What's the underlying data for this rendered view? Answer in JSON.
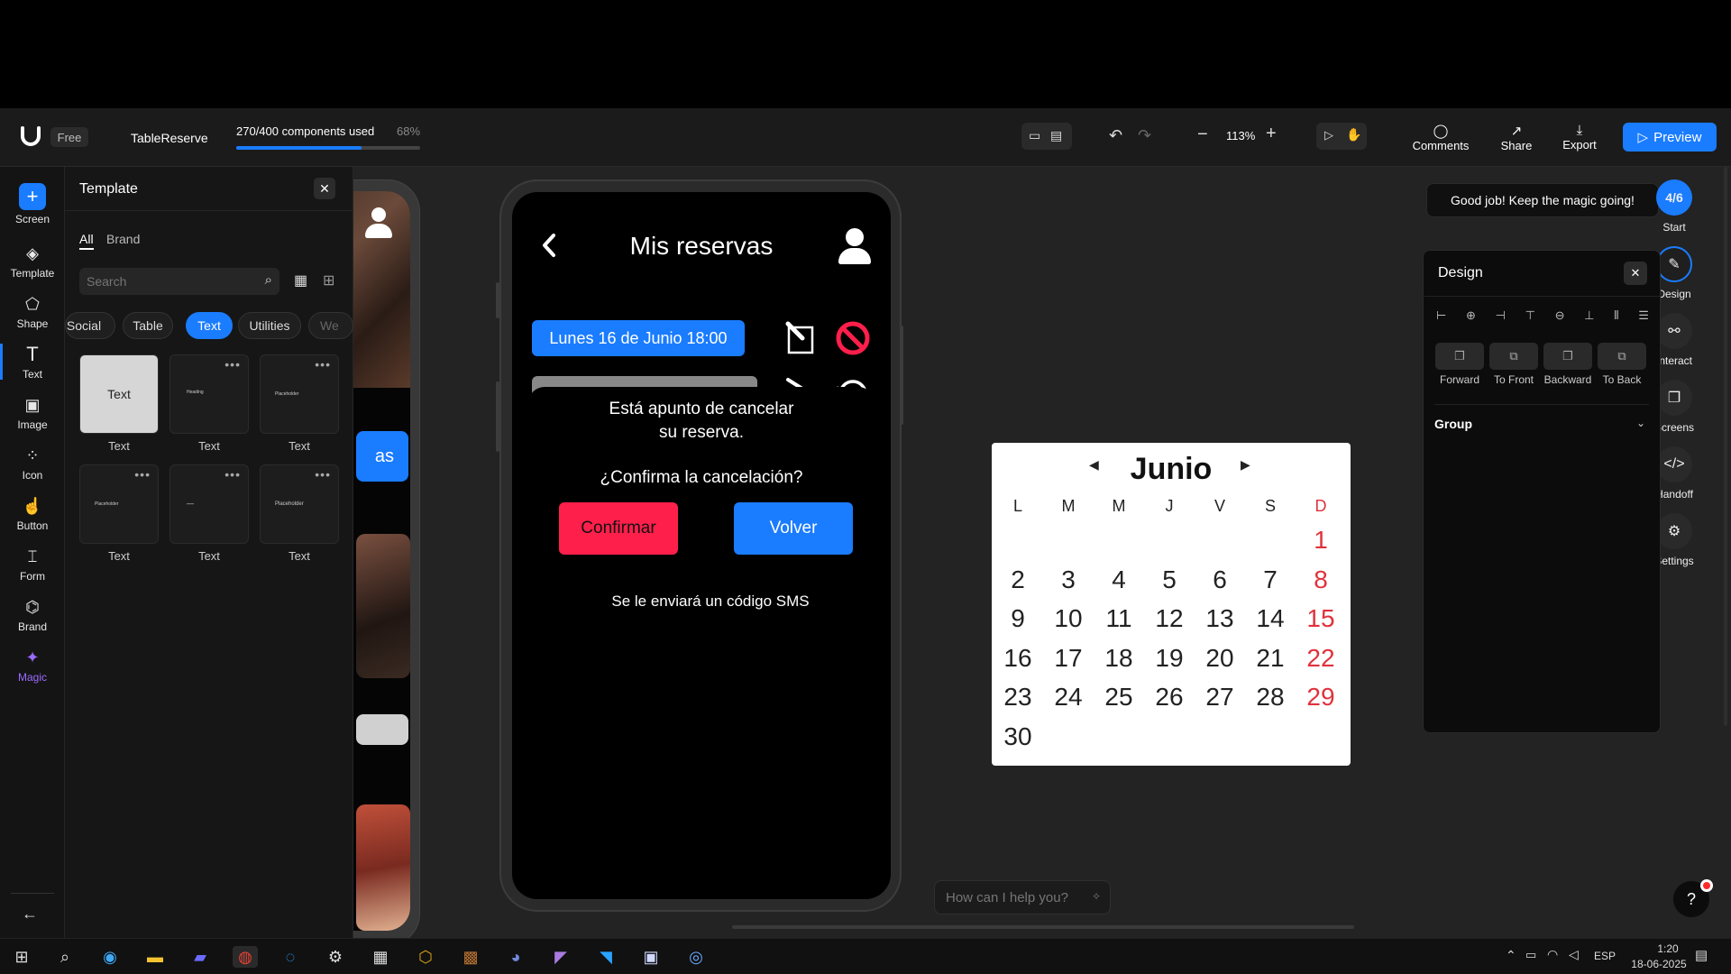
{
  "app": {
    "plan_badge": "Free",
    "project_name": "TableReserve",
    "usage_text": "270/400 components used",
    "usage_percent_label": "68%",
    "usage_fraction": 0.68,
    "zoom": "113%",
    "comments_label": "Comments",
    "share_label": "Share",
    "export_label": "Export",
    "preview_label": "Preview",
    "accent": "#1a7cff"
  },
  "left_rail": {
    "items": [
      {
        "label": "Screen",
        "icon": "plus-icon"
      },
      {
        "label": "Template",
        "icon": "layers-icon"
      },
      {
        "label": "Shape",
        "icon": "shape-icon"
      },
      {
        "label": "Text",
        "icon": "text-icon"
      },
      {
        "label": "Image",
        "icon": "image-icon"
      },
      {
        "label": "Icon",
        "icon": "icon-icon"
      },
      {
        "label": "Button",
        "icon": "button-icon"
      },
      {
        "label": "Form",
        "icon": "form-icon"
      },
      {
        "label": "Brand",
        "icon": "brand-icon"
      },
      {
        "label": "Magic",
        "icon": "magic-icon"
      }
    ]
  },
  "template_panel": {
    "title": "Template",
    "tab_all": "All",
    "tab_brand": "Brand",
    "search_placeholder": "Search",
    "chips": [
      "Social",
      "Table",
      "Text",
      "Utilities",
      "We"
    ],
    "cards": [
      {
        "label": "Text",
        "preview": "Text"
      },
      {
        "label": "Text",
        "preview": "Heading"
      },
      {
        "label": "Text",
        "preview": "Placeholder"
      },
      {
        "label": "Text",
        "preview": "Placeholder"
      },
      {
        "label": "Text",
        "preview": "—"
      },
      {
        "label": "Text",
        "preview": "Placeholder"
      }
    ]
  },
  "phone": {
    "header_title": "Mis reservas",
    "reservation_label": "Lunes 16 de Junio 18:00",
    "dialog_line1": "Está apunto de cancelar",
    "dialog_line2": "su reserva.",
    "dialog_question": "¿Confirma la cancelación?",
    "confirm_label": "Confirmar",
    "back_label": "Volver",
    "sms_note": "Se le enviará un código SMS",
    "confirm_color": "#ff1f4b",
    "back_color": "#1a7cff"
  },
  "left_phone_partial": {
    "button_text": "as"
  },
  "calendar": {
    "month": "Junio",
    "weekday_headers": [
      "L",
      "M",
      "M",
      "J",
      "V",
      "S",
      "D"
    ],
    "weeks": [
      [
        "",
        "",
        "",
        "",
        "",
        "",
        "1"
      ],
      [
        "2",
        "3",
        "4",
        "5",
        "6",
        "7",
        "8"
      ],
      [
        "9",
        "10",
        "11",
        "12",
        "13",
        "14",
        "15"
      ],
      [
        "16",
        "17",
        "18",
        "19",
        "20",
        "21",
        "22"
      ],
      [
        "23",
        "24",
        "25",
        "26",
        "27",
        "28",
        "29"
      ],
      [
        "30",
        "",
        "",
        "",
        "",
        "",
        ""
      ]
    ],
    "sunday_color": "#e0323c"
  },
  "right_side": {
    "toast": "Good job! Keep the magic going!",
    "progress_badge": "4/6",
    "start_label": "Start",
    "buttons": [
      "Design",
      "Interact",
      "Screens",
      "Handoff",
      "Settings"
    ]
  },
  "design_panel": {
    "title": "Design",
    "arrange": [
      "Forward",
      "To Front",
      "Backward",
      "To Back"
    ],
    "group_label": "Group"
  },
  "chat": {
    "placeholder": "How can I help you?"
  },
  "taskbar": {
    "language": "ESP",
    "time": "1:20",
    "date": "18-06-2025"
  }
}
